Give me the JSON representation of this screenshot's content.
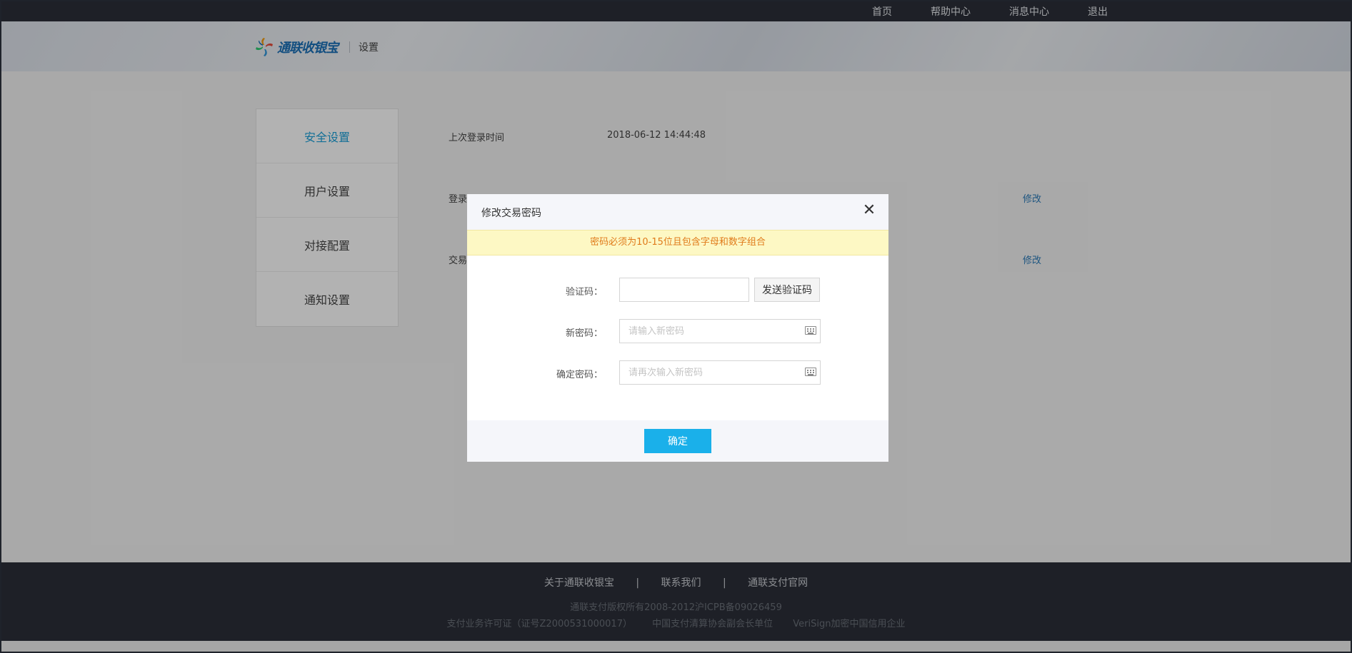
{
  "topnav": {
    "items": [
      "首页",
      "帮助中心",
      "消息中心",
      "退出"
    ]
  },
  "header": {
    "logo_text": "通联收银宝",
    "page_name": "设置"
  },
  "sidebar": {
    "items": [
      {
        "label": "安全设置",
        "active": true
      },
      {
        "label": "用户设置",
        "active": false
      },
      {
        "label": "对接配置",
        "active": false
      },
      {
        "label": "通知设置",
        "active": false
      }
    ]
  },
  "content": {
    "last_login_label": "上次登录时间",
    "last_login_value": "2018-06-12 14:44:48",
    "login_pwd_label": "登录",
    "trade_pwd_label": "交易",
    "modify_link": "修改"
  },
  "modal": {
    "title": "修改交易密码",
    "close_icon": "close-icon",
    "notice": "密码必须为10-15位且包含字母和数字组合",
    "code_label": "验证码：",
    "send_code_button": "发送验证码",
    "new_pwd_label": "新密码：",
    "new_pwd_placeholder": "请输入新密码",
    "confirm_pwd_label": "确定密码：",
    "confirm_pwd_placeholder": "请再次输入新密码",
    "confirm_button": "确定"
  },
  "footer": {
    "links": [
      "关于通联收银宝",
      "联系我们",
      "通联支付官网"
    ],
    "separator": "|",
    "copyright": "通联支付版权所有2008-2012沪ICPB备09026459",
    "info": [
      "支付业务许可证（证号Z2000531000017）",
      "中国支付清算协会副会长单位",
      "VeriSign加密中国信用企业"
    ]
  },
  "colors": {
    "accent": "#1ab0ea",
    "active_nav": "#1aa0d8",
    "notice_text": "#e07b1b",
    "link": "#2a7ab8"
  }
}
